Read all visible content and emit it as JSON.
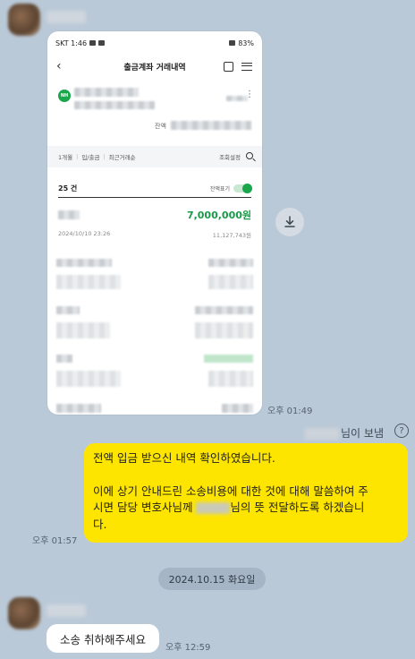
{
  "chat": {
    "image_message": {
      "time": "오후 01:49",
      "screenshot": {
        "status_bar": {
          "carrier_time": "SKT 1:46",
          "battery": "83%"
        },
        "title": "출금계좌 거래내역",
        "balance_label": "잔액",
        "filters": [
          "1개월",
          "입/출금",
          "최근거래순"
        ],
        "settings_label": "조회설정",
        "count_label": "25 건",
        "toggle_label": "잔액표기",
        "amount": "7,000,000원",
        "tx_datetime": "2024/10/10 23:26",
        "tx_balance": "11,127,743원"
      }
    },
    "sender_suffix": "님이 보냄",
    "outgoing_message": {
      "line1": "전액 입금 받으신 내역 확인하였습니다.",
      "line2": "이에 상기 안내드린 소송비용에 대한 것에 대해 말씀하여 주",
      "line3_pre": "시면 담당 변호사님께 ",
      "line3_post": "님의 뜻 전달하도록 하겠습니",
      "line4": "다.",
      "time": "오후 01:57"
    },
    "date_separator": "2024.10.15 화요일",
    "incoming_message": {
      "text": "소송 취하해주세요",
      "time": "오후 12:59"
    }
  },
  "colors": {
    "chat_bg": "#bac9d8",
    "my_bubble": "#fee500",
    "their_bubble": "#ffffff",
    "amount_green": "#1a9a48"
  },
  "icons": [
    "download-icon",
    "question-icon",
    "back-arrow-icon",
    "home-icon",
    "menu-icon",
    "search-icon"
  ]
}
